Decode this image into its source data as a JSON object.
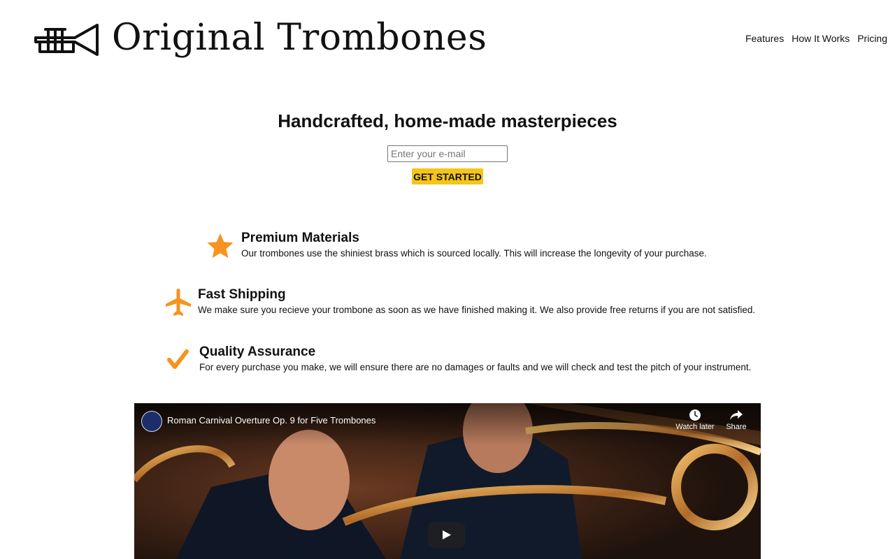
{
  "header": {
    "brand": "Original Trombones",
    "nav": [
      "Features",
      "How It Works",
      "Pricing"
    ]
  },
  "hero": {
    "title": "Handcrafted, home-made masterpieces",
    "email_placeholder": "Enter your e-mail",
    "cta_label": "GET STARTED"
  },
  "features": [
    {
      "icon": "star-icon",
      "title": "Premium Materials",
      "text": "Our trombones use the shiniest brass which is sourced locally. This will increase the longevity of your purchase."
    },
    {
      "icon": "plane-icon",
      "title": "Fast Shipping",
      "text": "We make sure you recieve your trombone as soon as we have finished making it. We also provide free returns if you are not satisfied."
    },
    {
      "icon": "check-icon",
      "title": "Quality Assurance",
      "text": "For every purchase you make, we will ensure there are no damages or faults and we will check and test the pitch of your instrument."
    }
  ],
  "video": {
    "title": "Roman Carnival Overture Op. 9 for Five Trombones",
    "watch_later": "Watch later",
    "share": "Share"
  },
  "colors": {
    "accent": "#f5c518",
    "icon_orange": "#f7931e"
  }
}
